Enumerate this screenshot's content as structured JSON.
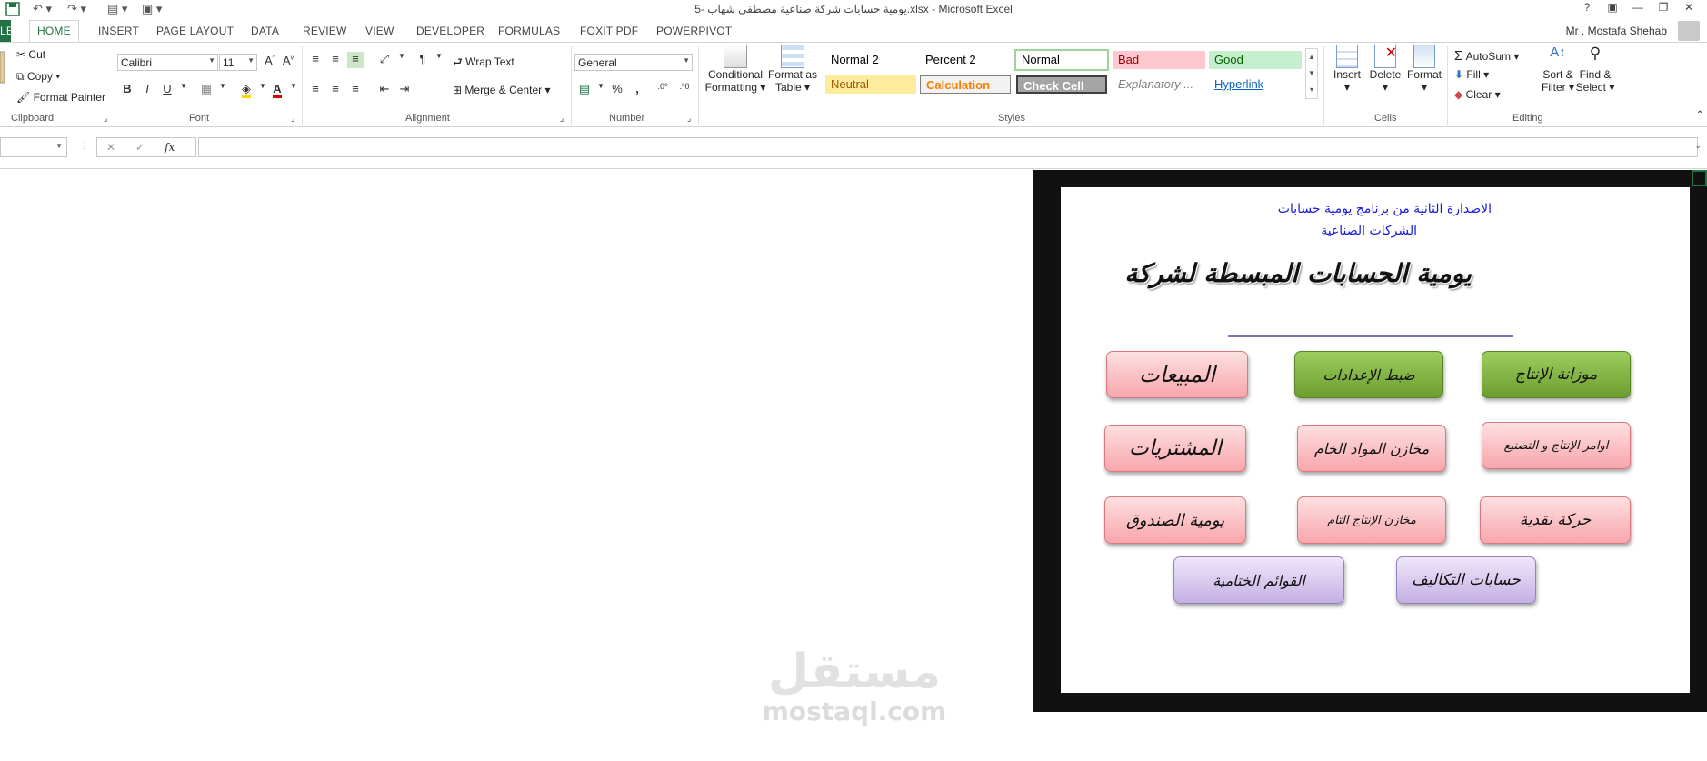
{
  "window": {
    "title": "يومية حسابات شركة صناعية مصطفى شهاب -5.xlsx - Microsoft Excel",
    "controls": [
      "?",
      "▣",
      "—",
      "❐",
      "✕"
    ]
  },
  "tabs": [
    "FILE",
    "HOME",
    "INSERT",
    "PAGE LAYOUT",
    "DATA",
    "REVIEW",
    "VIEW",
    "DEVELOPER",
    "FORMULAS",
    "FOXIT PDF",
    "POWERPIVOT"
  ],
  "tabs_visible": [
    "LE",
    "HOME",
    "INSERT",
    "PAGE LAYOUT",
    "DATA",
    "REVIEW",
    "VIEW",
    "DEVELOPER",
    "FORMULAS",
    "FOXIT PDF",
    "POWERPIVOT"
  ],
  "user": "Mr . Mostafa Shehab",
  "ribbon": {
    "clipboard": {
      "cut": "Cut",
      "copy": "Copy",
      "format_painter": "Format Painter",
      "label": "Clipboard"
    },
    "font": {
      "name": "Calibri",
      "size": "11",
      "bold": "B",
      "italic": "I",
      "underline": "U",
      "label": "Font"
    },
    "alignment": {
      "wrap": "Wrap Text",
      "merge": "Merge & Center",
      "label": "Alignment"
    },
    "number": {
      "format": "General",
      "percent": "%",
      "comma": ",",
      "label": "Number"
    },
    "styles": {
      "conditional": [
        "Conditional",
        "Formatting"
      ],
      "format_table": [
        "Format as",
        "Table"
      ],
      "cells": [
        {
          "label": "Normal 2",
          "bg": "#ffffff",
          "fg": "#000000"
        },
        {
          "label": "Percent 2",
          "bg": "#ffffff",
          "fg": "#000000"
        },
        {
          "label": "Normal",
          "bg": "#ffffff",
          "fg": "#000000"
        },
        {
          "label": "Bad",
          "bg": "#ffc7ce",
          "fg": "#9c0006"
        },
        {
          "label": "Good",
          "bg": "#c6efce",
          "fg": "#006100"
        },
        {
          "label": "Neutral",
          "bg": "#ffeb9c",
          "fg": "#9c5700"
        },
        {
          "label": "Calculation",
          "bg": "#f2f2f2",
          "fg": "#fa7d00"
        },
        {
          "label": "Check Cell",
          "bg": "#a5a5a5",
          "fg": "#ffffff"
        },
        {
          "label": "Explanatory ...",
          "bg": "#ffffff",
          "fg": "#7f7f7f"
        },
        {
          "label": "Hyperlink",
          "bg": "#ffffff",
          "fg": "#0563c1"
        }
      ],
      "label": "Styles"
    },
    "cells": {
      "insert": "Insert",
      "delete": "Delete",
      "format": "Format",
      "label": "Cells"
    },
    "editing": {
      "autosum": "AutoSum",
      "fill": "Fill",
      "clear": "Clear",
      "sort": [
        "Sort &",
        "Filter"
      ],
      "find": [
        "Find &",
        "Select"
      ],
      "label": "Editing"
    }
  },
  "formula_bar": {
    "fx": "fx",
    "value": ""
  },
  "panel": {
    "subtitle_line1": "الاصدارة الثانية من برنامج يومية حسابات",
    "subtitle_line2": "الشركات الصناعية",
    "title": "يومية الحسابات المبسطة لشركة",
    "buttons": [
      {
        "label": "المبيعات",
        "color": "pink"
      },
      {
        "label": "ضبط الإعدادات",
        "color": "green"
      },
      {
        "label": "موزانة الإنتاج",
        "color": "green"
      },
      {
        "label": "المشتريات",
        "color": "pink"
      },
      {
        "label": "مخازن المواد الخام",
        "color": "pink"
      },
      {
        "label": "اوامر الإنتاج و التصنيع",
        "color": "pink"
      },
      {
        "label": "يومية الصندوق",
        "color": "pink"
      },
      {
        "label": "مخازن الإنتاج التام",
        "color": "pink"
      },
      {
        "label": "حركة نقدية",
        "color": "pink"
      },
      {
        "label": "القوائم الختامية",
        "color": "purple"
      },
      {
        "label": "حسابات التكاليف",
        "color": "purple"
      }
    ]
  },
  "watermark": {
    "arabic": "مستقل",
    "latin": "mostaql.com"
  }
}
